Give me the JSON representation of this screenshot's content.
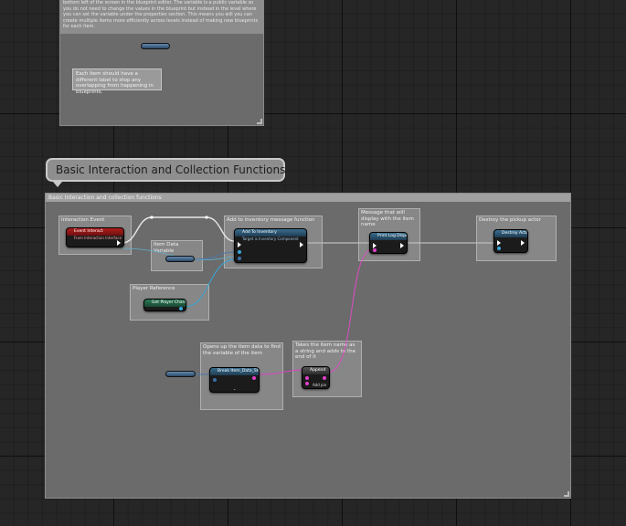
{
  "top_comment": {
    "text": "bottom left of the screen in the blueprint editor. The variable is a public variable so you do not need to change the values in the blueprint but instead in the level where you can set the variable under the properties section. This means you will you can create multiple items more efficiently across levels instead of making new blueprints for each item.",
    "note": "Each item should have a different label to stop any overlapping from happening in blueprints."
  },
  "section_bubble": {
    "title": "Basic Interaction and Collection Functions"
  },
  "main_comment": {
    "header": "Basic Interaction and collection functions"
  },
  "sub_comments": {
    "interaction_event": "Interaction Event",
    "item_data_variable": "Item Data Variable",
    "add_message": "Add to inventory message function",
    "print_message": "Message that will display with the item name",
    "destroy": "Destroy the pickup actor",
    "player_reference": "Player Reference",
    "break_struct": "Opens up the item data to find the variable of the item",
    "append": "Takes the item name as a string and adds to the end of it"
  },
  "nodes": {
    "event_interact": {
      "title": "Event Interact",
      "subtitle": "From Interaction Interface"
    },
    "add_to_inventory": {
      "title": "Add To Inventory",
      "subtitle": "Target is Inventory Component"
    },
    "print_string": {
      "title": "Print Log Display"
    },
    "destroy_actor": {
      "title": "Destroy Actor"
    },
    "get_player_character": {
      "title": "Get Player Character"
    },
    "break_struct": {
      "title": "Break Item_Data_Struct"
    },
    "append": {
      "title": "Append",
      "pin_label": "Add pin"
    }
  },
  "colors": {
    "exec_wire": "#ffffff",
    "object_wire": "#39a7d8",
    "string_wire": "#e040c8",
    "struct_wire": "#3b6ea8"
  }
}
